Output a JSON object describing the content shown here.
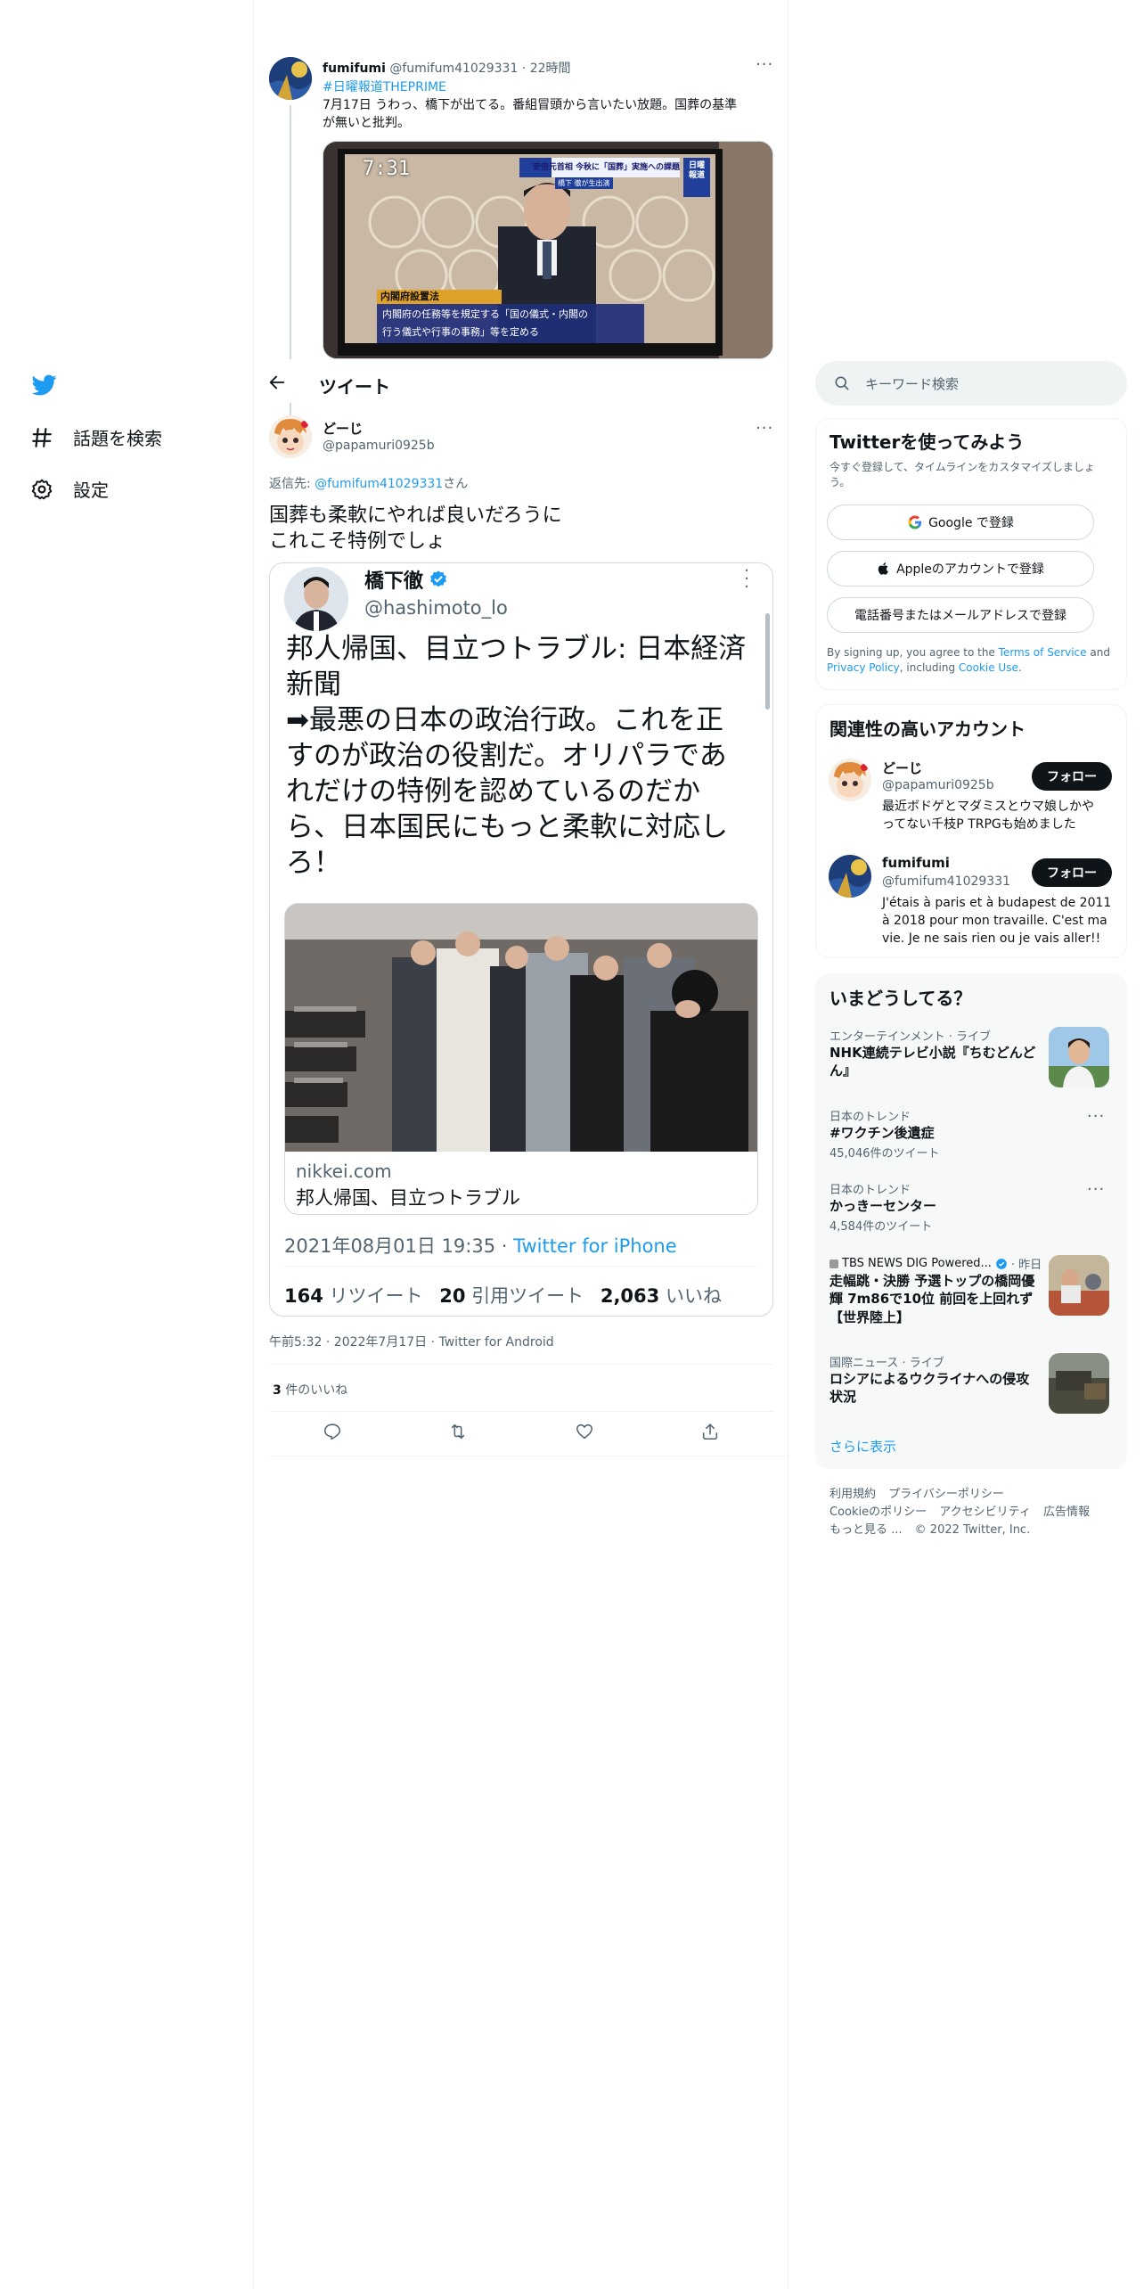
{
  "nav": {
    "items": [
      {
        "label": "話題を検索",
        "icon": "hashtag-icon"
      },
      {
        "label": "設定",
        "icon": "gear-icon"
      }
    ]
  },
  "parent_tweet": {
    "display_name": "fumifumi",
    "handle": "@fumifum41029331",
    "separator": "·",
    "time": "22時間",
    "hashtag": "#日曜報道THEPRIME",
    "text_line1": "7月17日 うわっ、橋下が出てる。番組冒頭から言いたい放題。国葬の基準",
    "text_line2": "が無いと批判。",
    "tv_time": "7:31",
    "tv_banner_top": "安倍元首相 今秋に「国葬」実施への課題",
    "tv_banner_sub": "橋下 徹が生出演",
    "tv_logo": "日曜報道",
    "tv_law_title": "内閣府設置法",
    "tv_caption1": "内閣府の任務等を規定する「国の儀式・内閣の",
    "tv_caption2": "行う儀式や行事の事務」等を定める"
  },
  "header": {
    "title": "ツイート"
  },
  "main_tweet": {
    "display_name": "どーじ",
    "handle": "@papamuri0925b",
    "reply_prefix": "返信先:",
    "reply_handle": "@fumifum41029331",
    "reply_suffix": "さん",
    "text_line1": "国葬も柔軟にやれば良いだろうに",
    "text_line2": "これこそ特例でしょ",
    "meta": "午前5:32 · 2022年7月17日 · Twitter for Android",
    "likes_count": "3",
    "likes_label": "件のいいね"
  },
  "embedded": {
    "name": "橋下徹",
    "handle": "@hashimoto_lo",
    "text_lines": [
      "邦人帰国、目立つトラブル: 日本経済",
      "新聞",
      "➡最悪の日本の政治行政。これを正",
      "すのが政治の役割だ。オリパラであ",
      "れだけの特例を認めているのだか",
      "ら、日本国民にもっと柔軟に対応し",
      "ろ！"
    ],
    "link_domain": "nikkei.com",
    "link_title": "邦人帰国、目立つトラブル",
    "date": "2021年08月01日 19:35",
    "dot": "·",
    "source": "Twitter for iPhone",
    "retweets": "164",
    "retweets_label": "リツイート",
    "quotes": "20",
    "quotes_label": "引用ツイート",
    "likes": "2,063",
    "likes_label": "いいね"
  },
  "search": {
    "placeholder": "キーワード検索"
  },
  "signup": {
    "title": "Twitterを使ってみよう",
    "subtitle_line1": "今すぐ登録して、タイムラインをカスタマイズしましょ",
    "subtitle_line2": "う。",
    "google_button": "Google で登録",
    "apple_button": "Appleのアカウントで登録",
    "phone_button": "電話番号またはメールアドレスで登録",
    "legal_1": "By signing up, you agree to the",
    "legal_terms": "Terms of Service",
    "legal_and": "and",
    "legal_privacy": "Privacy Policy",
    "legal_including": ", including",
    "legal_cookie": "Cookie Use",
    "legal_end": "."
  },
  "relevant": {
    "title": "関連性の高いアカウント",
    "follow_label": "フォロー",
    "accounts": [
      {
        "name": "どーじ",
        "handle": "@papamuri0925b",
        "bio_line1": "最近ボドゲとマダミスとウマ娘しかや",
        "bio_line2": "ってない千枝P TRPGも始めました",
        "bio_line3": ""
      },
      {
        "name": "fumifumi",
        "handle": "@fumifum41029331",
        "bio_line1": "J'étais à paris et à budapest de 2011",
        "bio_line2": "à 2018 pour mon travaille. C'est ma",
        "bio_line3": "vie. Je ne sais rien ou je vais aller!!"
      }
    ]
  },
  "trends": {
    "title": "いまどうしてる？",
    "items": [
      {
        "category": "エンターテインメント · ライブ",
        "title_line1": "NHK連続テレビ小説『ちむどんど",
        "title_line2": "ん』",
        "count": ""
      },
      {
        "category": "日本のトレンド",
        "title_line1": "#ワクチン後遺症",
        "title_line2": "",
        "count": "45,046件のツイート"
      },
      {
        "category": "日本のトレンド",
        "title_line1": "かっきーセンター",
        "title_line2": "",
        "count": "4,584件のツイート"
      },
      {
        "category": "TBS NEWS DIG Powered...",
        "category_suffix": "· 昨日",
        "title_line1": "走幅跳・決勝 予選トップの橋岡優",
        "title_line2": "輝 7m86で10位 前回を上回れず",
        "title_line3": "【世界陸上】",
        "count": ""
      },
      {
        "category": "国際ニュース · ライブ",
        "title_line1": "ロシアによるウクライナへの侵攻",
        "title_line2": "状況",
        "count": ""
      }
    ],
    "show_more": "さらに表示"
  },
  "footer": {
    "line1": [
      "利用規約",
      "プライバシーポリシー"
    ],
    "line2": [
      "Cookieのポリシー",
      "アクセシビリティ",
      "広告情報"
    ],
    "more": "もっと見る ...",
    "copyright": "© 2022 Twitter, Inc."
  },
  "colors": {
    "accent": "#1d9bf0",
    "text": "#0f1419",
    "muted": "#536471",
    "border": "#eff3f4"
  }
}
